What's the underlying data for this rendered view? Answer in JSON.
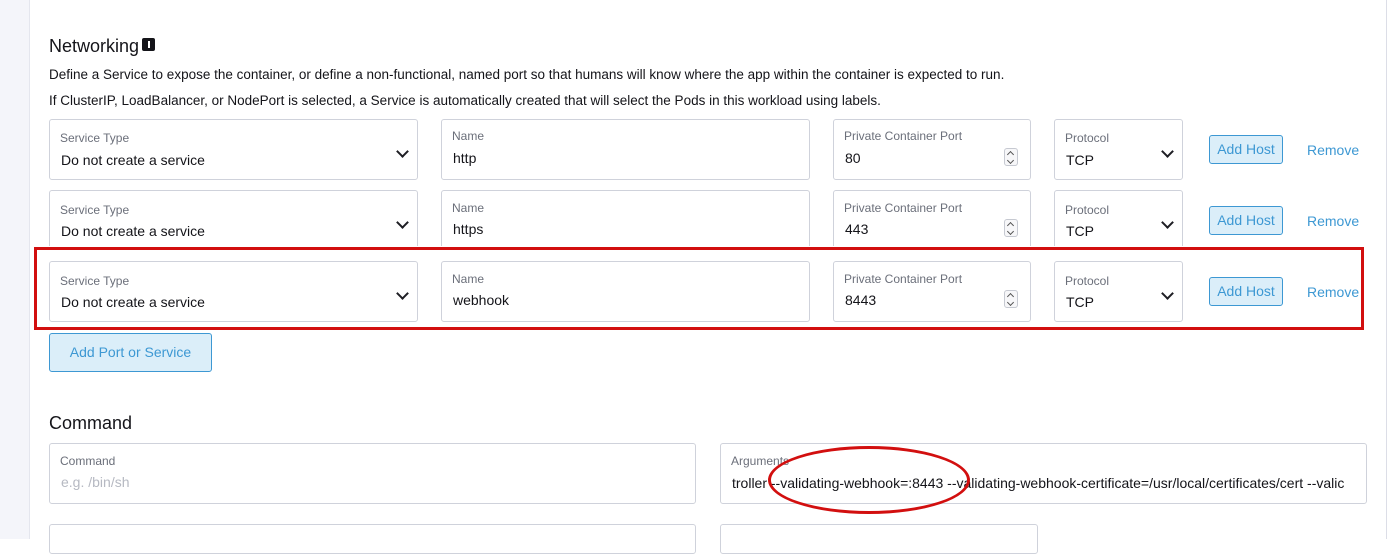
{
  "networking": {
    "title": "Networking",
    "info_icon": "info-icon",
    "description_1": "Define a Service to expose the container, or define a non-functional, named port so that humans will know where the app within the container is expected to run.",
    "description_2": "If ClusterIP, LoadBalancer, or NodePort is selected, a Service is automatically created that will select the Pods in this workload using labels.",
    "labels": {
      "service_type": "Service Type",
      "name": "Name",
      "port": "Private Container Port",
      "protocol": "Protocol"
    },
    "rows": [
      {
        "service_type": "Do not create a service",
        "name": "http",
        "port": "80",
        "protocol": "TCP",
        "add_host": "Add Host",
        "remove": "Remove"
      },
      {
        "service_type": "Do not create a service",
        "name": "https",
        "port": "443",
        "protocol": "TCP",
        "add_host": "Add Host",
        "remove": "Remove"
      },
      {
        "service_type": "Do not create a service",
        "name": "webhook",
        "port": "8443",
        "protocol": "TCP",
        "add_host": "Add Host",
        "remove": "Remove"
      }
    ],
    "add_port_label": "Add Port or Service"
  },
  "command": {
    "title": "Command",
    "command_label": "Command",
    "command_placeholder": "e.g. /bin/sh",
    "arguments_label": "Arguments",
    "arguments_value": "troller --validating-webhook=:8443 --validating-webhook-certificate=/usr/local/certificates/cert --valic"
  },
  "annotation": {
    "color": "#d20f0f"
  }
}
